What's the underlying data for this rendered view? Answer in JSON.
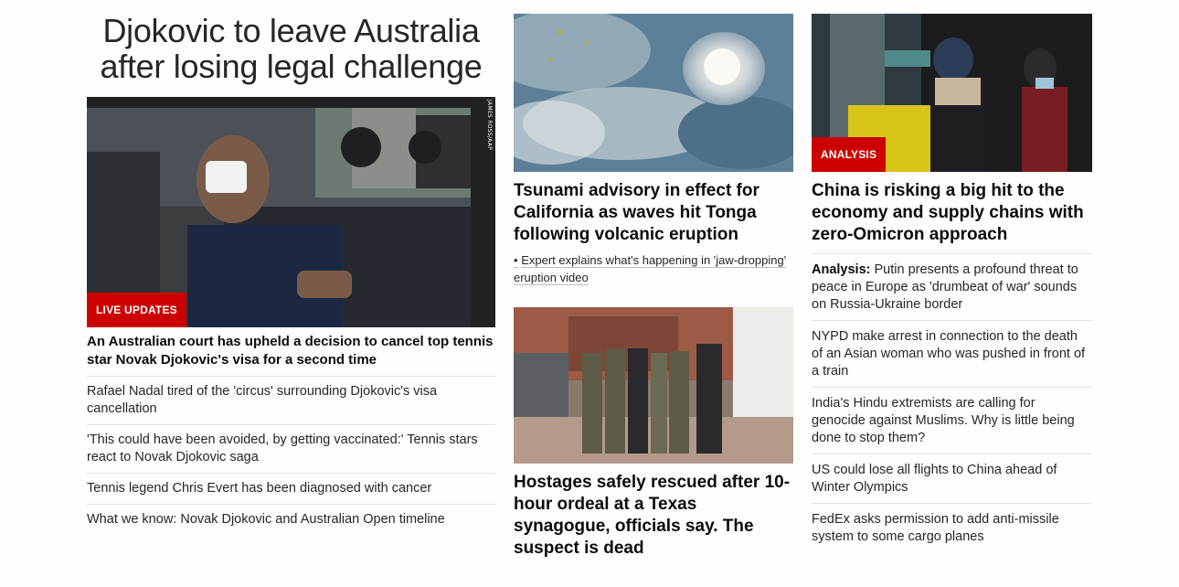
{
  "lead": {
    "title": "Djokovic to leave Australia after losing legal challenge",
    "badge": "LIVE UPDATES",
    "photo_credit": "JAMES ROSS/AAP",
    "photo_alt": "djokovic-in-car-photo",
    "headline": "An Australian court has upheld a decision to cancel top tennis star Novak Djokovic's visa for a second time",
    "related": [
      "Rafael Nadal tired of the 'circus' surrounding Djokovic's visa cancellation",
      "'This could have been avoided, by getting vaccinated:' Tennis stars react to Novak Djokovic saga",
      "Tennis legend Chris Evert has been diagnosed with cancer",
      "What we know: Novak Djokovic and Australian Open timeline"
    ]
  },
  "middle": {
    "story1": {
      "headline": "Tsunami advisory in effect for California as waves hit Tonga following volcanic eruption",
      "sub_link": "Expert explains what's happening in 'jaw-dropping' eruption video",
      "bullet": "•"
    },
    "story2": {
      "headline": "Hostages safely rescued after 10-hour ordeal at a Texas synagogue, officials say. The suspect is dead"
    }
  },
  "right": {
    "badge": "ANALYSIS",
    "headline": "China is risking a big hit to the economy and supply chains with zero-Omicron approach",
    "items": [
      {
        "prefix": "Analysis:",
        "text": " Putin presents a profound threat to peace in Europe as 'drumbeat of war' sounds on Russia-Ukraine border"
      },
      {
        "prefix": "",
        "text": "NYPD make arrest in connection to the death of an Asian woman who was pushed in front of a train"
      },
      {
        "prefix": "",
        "text": "India's Hindu extremists are calling for genocide against Muslims. Why is little being done to stop them?"
      },
      {
        "prefix": "",
        "text": "US could lose all flights to China ahead of Winter Olympics"
      },
      {
        "prefix": "",
        "text": "FedEx asks permission to add anti-missile system to some cargo planes"
      }
    ]
  },
  "colors": {
    "badge_red": "#cc0000",
    "text": "#262626",
    "divider": "#e4e4e4"
  }
}
